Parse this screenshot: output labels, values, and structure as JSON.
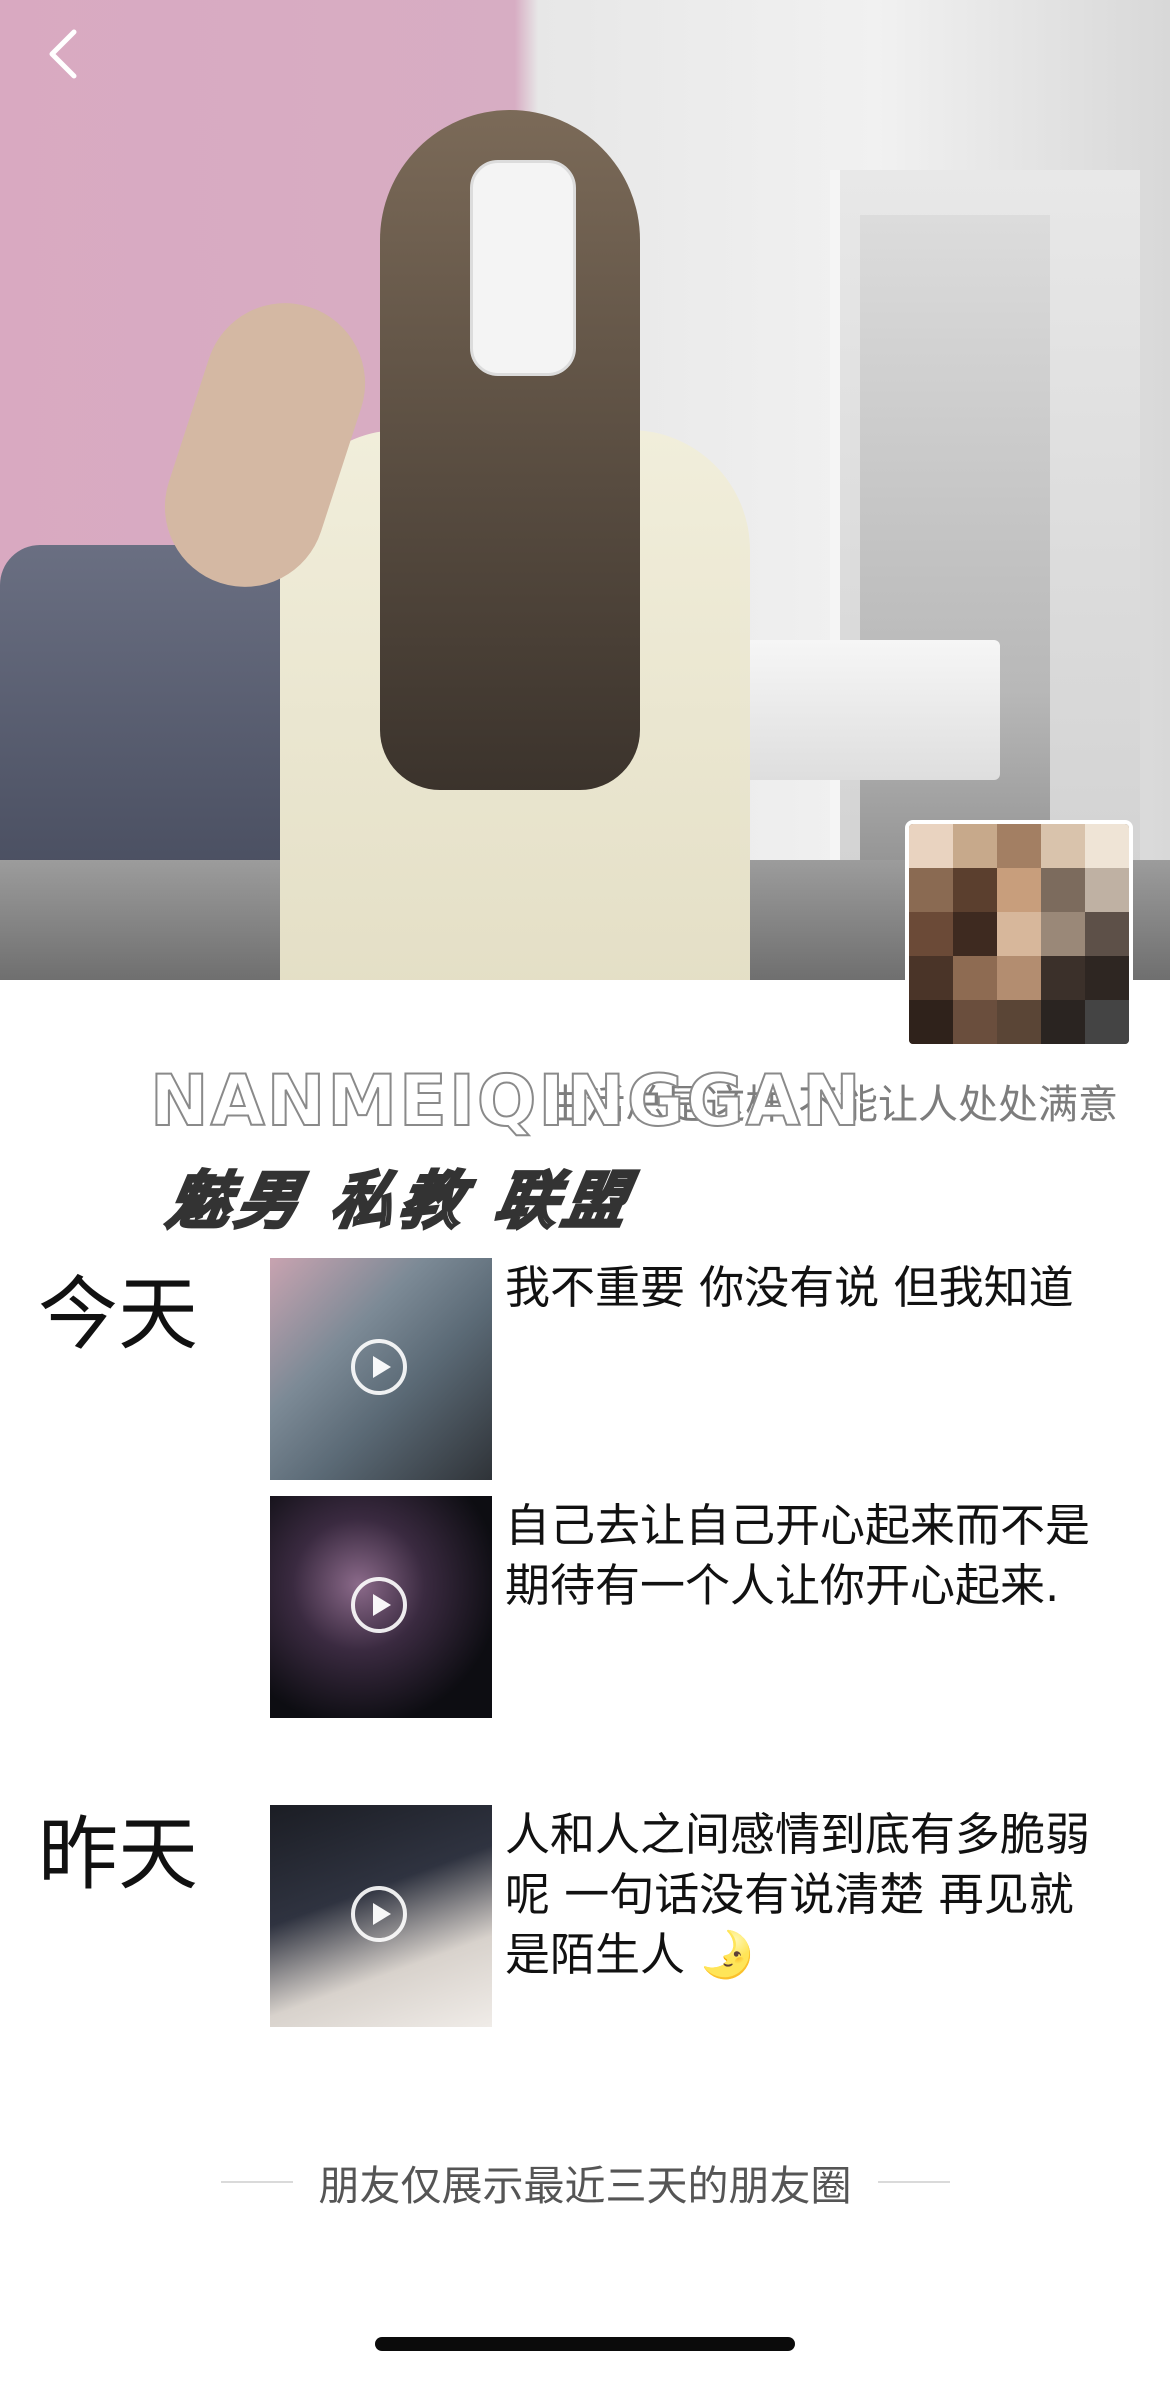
{
  "header": {
    "back_icon": "chevron-left-icon"
  },
  "cover": {
    "watermark_latin": "NANMEIQINGGAN",
    "watermark_cn": "魅男 私教 联盟"
  },
  "profile": {
    "signature": "生活总是这样 不能让人处处满意"
  },
  "feed": {
    "days": [
      {
        "label": "今天",
        "posts": [
          {
            "text": "我不重要 你没有说 但我知道",
            "media": "video"
          },
          {
            "text": "自己去让自己开心起来而不是期待有一个人让你开心起来.",
            "media": "video"
          }
        ]
      },
      {
        "label": "昨天",
        "posts": [
          {
            "text": "人和人之间感情到底有多脆弱呢 一句话没有说清楚 再见就是陌生人 🌛",
            "media": "video"
          }
        ]
      }
    ]
  },
  "footer": {
    "note": "朋友仅展示最近三天的朋友圈"
  },
  "colors": {
    "background": "#ffffff",
    "text": "#111111",
    "muted": "#7d7d7d",
    "divider": "#dadada",
    "home_indicator": "#0b0b0b"
  }
}
